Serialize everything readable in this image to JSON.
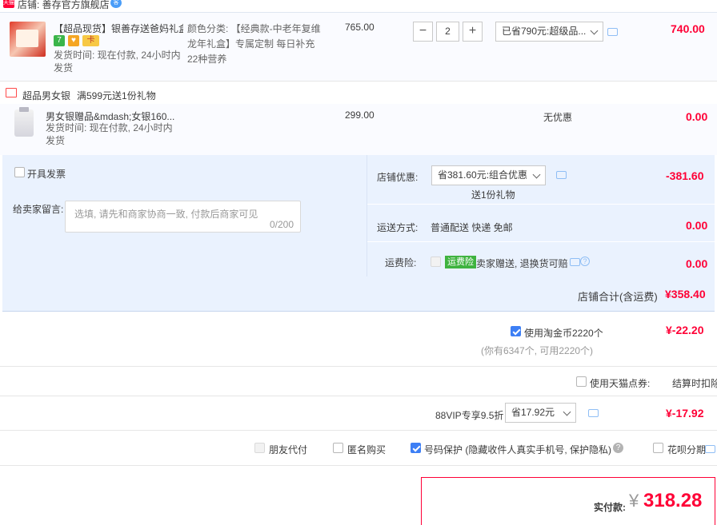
{
  "shop": {
    "badge": "天猫",
    "name": "店铺: 善存官方旗舰店",
    "chat_label": "客"
  },
  "item1": {
    "title": "【超品现货】银善存送爸妈礼盒...",
    "icons": [
      "7",
      "♥",
      "卡"
    ],
    "shipping": "发货时间: 现在付款, 24小时内发货",
    "sku": "颜色分类: 【经典款-中老年复维龙年礼盒】专属定制 每日补充22种营养",
    "price": "765.00",
    "qty": "2",
    "qty_minus": "−",
    "qty_plus": "+",
    "promo": "已省790元:超级品...",
    "subtotal": "740.00"
  },
  "gift": {
    "header": "超品男女银",
    "rule": "满599元送1份礼物",
    "title": "男女银赠品&mdash;女银160...",
    "shipping": "发货时间: 现在付款, 24小时内发货",
    "price": "299.00",
    "promo": "无优惠",
    "subtotal": "0.00"
  },
  "panel": {
    "invoice_label": "开具发票",
    "message_label": "给卖家留言:",
    "message_placeholder": "选填, 请先和商家协商一致, 付款后商家可见",
    "message_counter": "0/200",
    "discount_label": "店铺优惠:",
    "discount_select": "省381.60元:组合优惠",
    "discount_note": "送1份礼物",
    "discount_value": "-381.60",
    "delivery_label": "运送方式:",
    "delivery_value": "普通配送 快递 免邮",
    "delivery_price": "0.00",
    "insurance_label": "运费险:",
    "insurance_tag": "运费险",
    "insurance_text": "卖家赠送, 退换货可赔",
    "insurance_price": "0.00",
    "total_label": "店铺合计(含运费)",
    "total_value": "¥358.40"
  },
  "coins": {
    "label": "使用淘金币2220个",
    "note": "(你有6347个, 可用2220个)",
    "value": "¥-22.20"
  },
  "tmall_card": {
    "label": "使用天猫点券:",
    "note": "结算时扣除"
  },
  "vip": {
    "label": "88VIP专享9.5折",
    "select": "省17.92元",
    "value": "¥-17.92"
  },
  "options": {
    "friend_pay": "朋友代付",
    "anonymous": "匿名购买",
    "privacy": "号码保护 (隐藏收件人真实手机号, 保护隐私)",
    "huabei": "花呗分期"
  },
  "final": {
    "label": "实付款:",
    "currency": "¥",
    "amount": "318.28"
  },
  "colors": {
    "accent_red": "#ff0036",
    "accent_blue": "#3d7ff5",
    "panel_bg": "#eaf2fe"
  }
}
